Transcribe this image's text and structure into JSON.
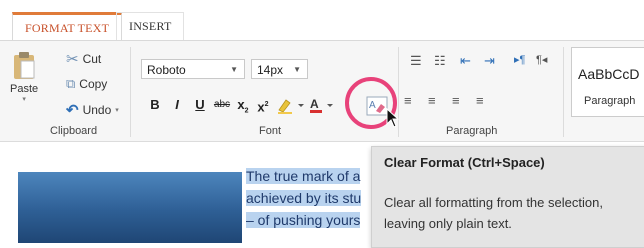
{
  "tabs": [
    "FORMAT TEXT",
    "INSERT"
  ],
  "clipboard": {
    "paste": "Paste",
    "cut": "Cut",
    "copy": "Copy",
    "undo": "Undo",
    "label": "Clipboard"
  },
  "font": {
    "family": "Roboto",
    "size": "14px",
    "label": "Font",
    "bold": "B",
    "italic": "I",
    "underline": "U",
    "strike": "abc",
    "sub": "x",
    "sup": "x"
  },
  "paragraph": {
    "label": "Paragraph"
  },
  "styles": {
    "sample": "AaBbCcD",
    "name": "Paragraph"
  },
  "document": {
    "lines": [
      "The true mark of a",
      "achieved by its stu",
      "– of pushing yours"
    ]
  },
  "tooltip": {
    "title": "Clear Format (Ctrl+Space)",
    "body": "Clear all formatting from the selection, leaving only plain text."
  },
  "colors": {
    "accent": "#e07b39",
    "highlight_ring": "#e8427a",
    "selection": "#b9d3ef"
  }
}
